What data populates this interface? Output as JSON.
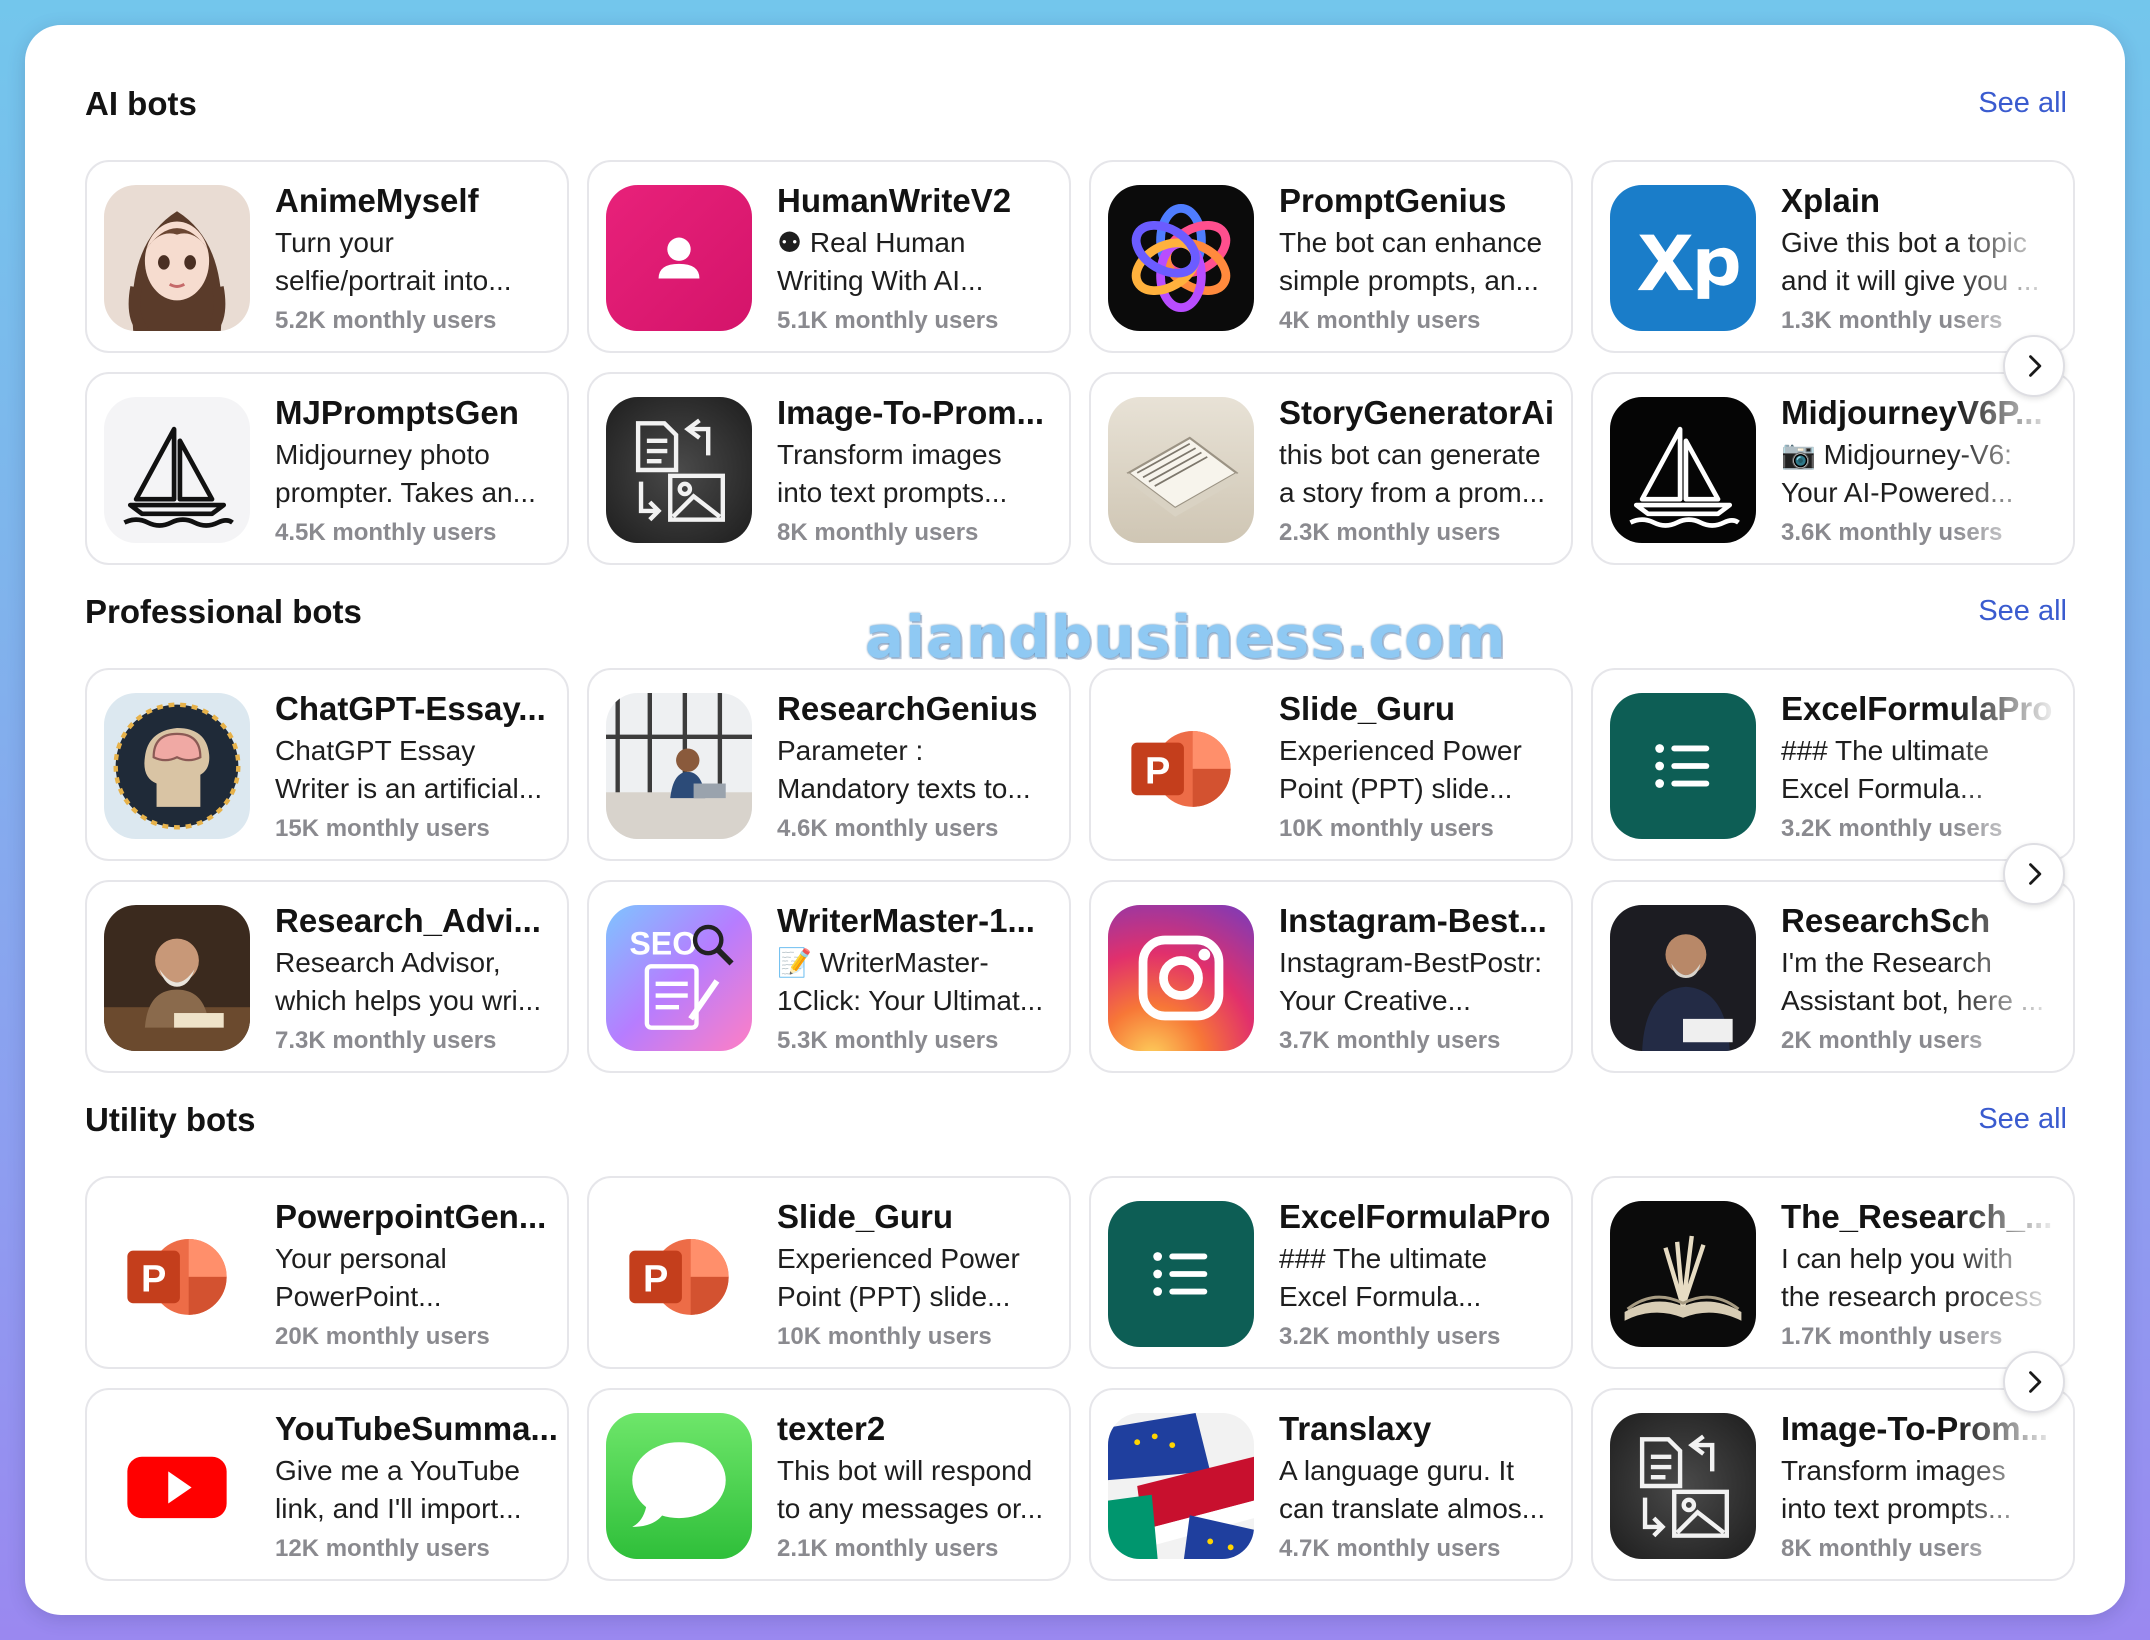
{
  "watermark": "aiandbusiness.com",
  "sections": [
    {
      "title": "AI bots",
      "see_all": "See all",
      "cards": [
        {
          "name": "AnimeMyself",
          "desc1": "Turn your",
          "desc2": "selfie/portrait into...",
          "users": "5.2K monthly users",
          "icon": "anime-portrait-avatar"
        },
        {
          "name": "HumanWriteV2",
          "desc1": "⚉ Real Human",
          "desc2": "Writing With AI...",
          "users": "5.1K monthly users",
          "icon": "person-icon"
        },
        {
          "name": "PromptGenius",
          "desc1": "The bot can enhance",
          "desc2": "simple prompts, an...",
          "users": "4K monthly users",
          "icon": "openai-logo"
        },
        {
          "name": "Xplain",
          "desc1": "Give this bot a topic",
          "desc2": "and it will give you ...",
          "users": "1.3K monthly users",
          "icon": "xp-logo"
        },
        {
          "name": "MJPromptsGen",
          "desc1": "Midjourney photo",
          "desc2": "prompter. Takes an...",
          "users": "4.5K monthly users",
          "icon": "sailboat-icon"
        },
        {
          "name": "Image-To-Prom...",
          "desc1": "Transform images",
          "desc2": "into text prompts...",
          "users": "8K monthly users",
          "icon": "image-to-text-icon"
        },
        {
          "name": "StoryGeneratorAi",
          "desc1": "this bot can generate",
          "desc2": "a story from a prom...",
          "users": "2.3K monthly users",
          "icon": "notebook-photo"
        },
        {
          "name": "MidjourneyV6P...",
          "desc1": "📷 Midjourney-V6:",
          "desc2": "Your AI-Powered...",
          "users": "3.6K monthly users",
          "icon": "sailboat-dark-icon"
        }
      ]
    },
    {
      "title": "Professional bots",
      "see_all": "See all",
      "cards": [
        {
          "name": "ChatGPT-Essay...",
          "desc1": "ChatGPT Essay",
          "desc2": "Writer is an artificial...",
          "users": "15K monthly users",
          "icon": "brain-head-illustration"
        },
        {
          "name": "ResearchGenius",
          "desc1": "Parameter :",
          "desc2": "Mandatory texts to...",
          "users": "4.6K monthly users",
          "icon": "office-man-photo"
        },
        {
          "name": "Slide_Guru",
          "desc1": "Experienced Power",
          "desc2": "Point (PPT) slide...",
          "users": "10K monthly users",
          "icon": "powerpoint-logo"
        },
        {
          "name": "ExcelFormulaPro",
          "desc1": "### The ultimate",
          "desc2": "Excel Formula...",
          "users": "3.2K monthly users",
          "icon": "list-icon"
        },
        {
          "name": "Research_Advi...",
          "desc1": "Research Advisor,",
          "desc2": "which helps you wri...",
          "users": "7.3K monthly users",
          "icon": "old-man-writing-photo"
        },
        {
          "name": "WriterMaster-1...",
          "desc1": "📝 WriterMaster-",
          "desc2": "1Click: Your Ultimat...",
          "users": "5.3K monthly users",
          "icon": "seo-document-icon"
        },
        {
          "name": "Instagram-Best...",
          "desc1": "Instagram-BestPostr:",
          "desc2": "Your Creative...",
          "users": "3.7K monthly users",
          "icon": "instagram-logo"
        },
        {
          "name": "ResearchSch",
          "desc1": "I'm the Research",
          "desc2": "Assistant bot, here ...",
          "users": "2K monthly users",
          "icon": "man-signing-photo"
        }
      ]
    },
    {
      "title": "Utility bots",
      "see_all": "See all",
      "cards": [
        {
          "name": "PowerpointGen...",
          "desc1": "Your personal",
          "desc2": "PowerPoint...",
          "users": "20K monthly users",
          "icon": "powerpoint-logo"
        },
        {
          "name": "Slide_Guru",
          "desc1": "Experienced Power",
          "desc2": "Point (PPT) slide...",
          "users": "10K monthly users",
          "icon": "powerpoint-logo"
        },
        {
          "name": "ExcelFormulaPro",
          "desc1": "### The ultimate",
          "desc2": "Excel Formula...",
          "users": "3.2K monthly users",
          "icon": "list-icon"
        },
        {
          "name": "The_Research_...",
          "desc1": "I can help you with",
          "desc2": "the research process",
          "users": "1.7K monthly users",
          "icon": "open-book-photo"
        },
        {
          "name": "YouTubeSumma...",
          "desc1": "Give me a YouTube",
          "desc2": "link, and I'll import...",
          "users": "12K monthly users",
          "icon": "youtube-logo"
        },
        {
          "name": "texter2",
          "desc1": "This bot will respond",
          "desc2": "to any messages or...",
          "users": "2.1K monthly users",
          "icon": "messages-bubble-icon"
        },
        {
          "name": "Translaxy",
          "desc1": "A language guru. It",
          "desc2": "can translate almos...",
          "users": "4.7K monthly users",
          "icon": "flags-collage"
        },
        {
          "name": "Image-To-Prom...",
          "desc1": "Transform images",
          "desc2": "into text prompts...",
          "users": "8K monthly users",
          "icon": "image-to-text-icon"
        }
      ]
    }
  ],
  "colors": {
    "accent_link": "#3a5bcf",
    "card_border": "#e6e6ea",
    "muted_text": "#8a8a8f",
    "background_gradient_top": "#73c6ec",
    "background_gradient_bottom": "#9a88f0"
  }
}
